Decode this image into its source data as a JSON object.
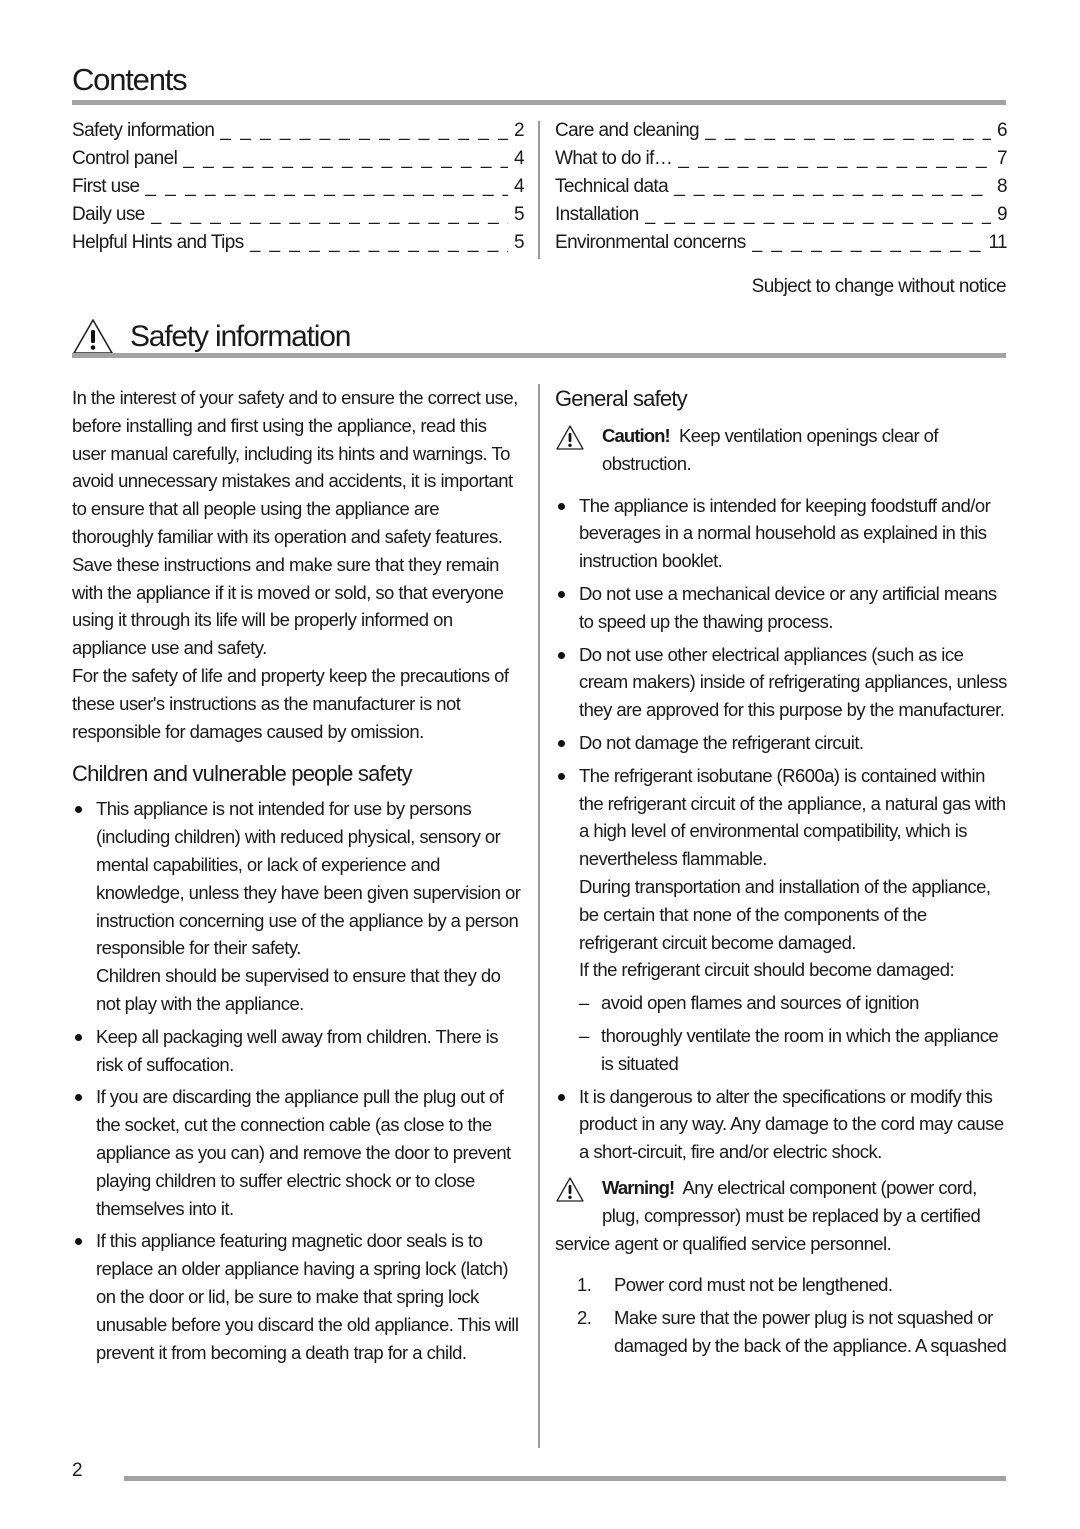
{
  "contents": {
    "title": "Contents",
    "left": [
      {
        "label": "Safety information",
        "page": "2"
      },
      {
        "label": "Control panel",
        "page": "4"
      },
      {
        "label": "First use",
        "page": "4"
      },
      {
        "label": "Daily use",
        "page": "5"
      },
      {
        "label": "Helpful Hints and Tips",
        "page": "5"
      }
    ],
    "right": [
      {
        "label": "Care and cleaning",
        "page": "6"
      },
      {
        "label": "What to do if…",
        "page": "7"
      },
      {
        "label": "Technical data",
        "page": "8"
      },
      {
        "label": "Installation",
        "page": "9"
      },
      {
        "label": "Environmental concerns",
        "page": "11"
      }
    ],
    "leader": "_ _ _ _ _ _ _ _ _ _ _ _ _ _ _ _ _ _ _ _ _ _ _ _ _ _ _ _ _ _ _ _ _ _ _ _",
    "notice": "Subject to change without notice"
  },
  "safety": {
    "title": "Safety information",
    "icon": "warning-triangle-icon",
    "intro": [
      "In the interest of your safety and to ensure the correct use, before installing and first using the appliance, read this user manual carefully, including its hints and warnings. To avoid unnecessary mistakes and accidents, it is important to ensure that all people using the appliance are thoroughly familiar with its operation and safety features. Save these instructions and make sure that they remain with the appliance if it is moved or sold, so that everyone using it through its life will be properly informed on appliance use and safety.",
      "For the safety of life and property keep the precautions of these user's instructions as the manufacturer is not responsible for damages caused by omission."
    ],
    "children": {
      "heading": "Children and vulnerable people safety",
      "bullets": [
        {
          "text": "This appliance is not intended for use by persons (including children) with reduced physical, sensory or mental capabilities, or lack of experience and knowledge, unless they have been given supervision or instruction concerning use of the appliance by a person responsible for their safety.",
          "extra": "Children should be supervised to ensure that they do not play with the appliance."
        },
        {
          "text": "Keep all packaging well away from children. There is risk of suffocation."
        },
        {
          "text": "If you are discarding the appliance pull the plug out of the socket, cut the connection cable (as close to the appliance as you can) and remove the door to prevent playing children to suffer electric shock or to close themselves into it."
        },
        {
          "text": "If this appliance featuring magnetic door seals is to replace an older appliance having a spring lock (latch) on the door or lid, be sure to make that spring lock unusable before you discard the old appliance. This will prevent it from becoming a death trap for a child."
        }
      ]
    },
    "general": {
      "heading": "General safety",
      "caution": {
        "keyword": "Caution!",
        "text": "Keep ventilation openings clear of obstruction."
      },
      "bullets": [
        {
          "text": "The appliance is intended for keeping foodstuff and/or beverages in a normal household as explained in this instruction booklet."
        },
        {
          "text": "Do not use a mechanical device or any artificial means to speed up the thawing process."
        },
        {
          "text": "Do not use other electrical appliances (such as ice cream makers) inside of refrigerating appliances, unless they are approved for this purpose by the manufacturer."
        },
        {
          "text": "Do not damage the refrigerant circuit."
        },
        {
          "text": "The refrigerant isobutane (R600a) is contained within the refrigerant circuit of the appliance, a natural gas with a high level of environmental compatibility, which is nevertheless flammable.",
          "extra": "During transportation and installation of the appliance, be certain that none of the components of the refrigerant circuit become damaged.",
          "extra2": "If the refrigerant circuit should become damaged:",
          "dashes": [
            "avoid open flames and sources of ignition",
            "thoroughly ventilate the room in which the appliance is situated"
          ]
        },
        {
          "text": "It is dangerous to alter the specifications or modify this product in any way. Any damage to the cord may cause a short-circuit, fire and/or electric shock."
        }
      ],
      "warning": {
        "keyword": "Warning!",
        "text": "Any electrical component (power cord, plug, compressor) must be replaced by a certified",
        "tail": "service agent or qualified service personnel."
      },
      "numbered": [
        {
          "num": "1.",
          "text": "Power cord must not be lengthened."
        },
        {
          "num": "2.",
          "text": "Make sure that the power plug is not squashed or damaged by the back of the appliance. A squashed"
        }
      ]
    }
  },
  "footer": {
    "page_number": "2"
  }
}
